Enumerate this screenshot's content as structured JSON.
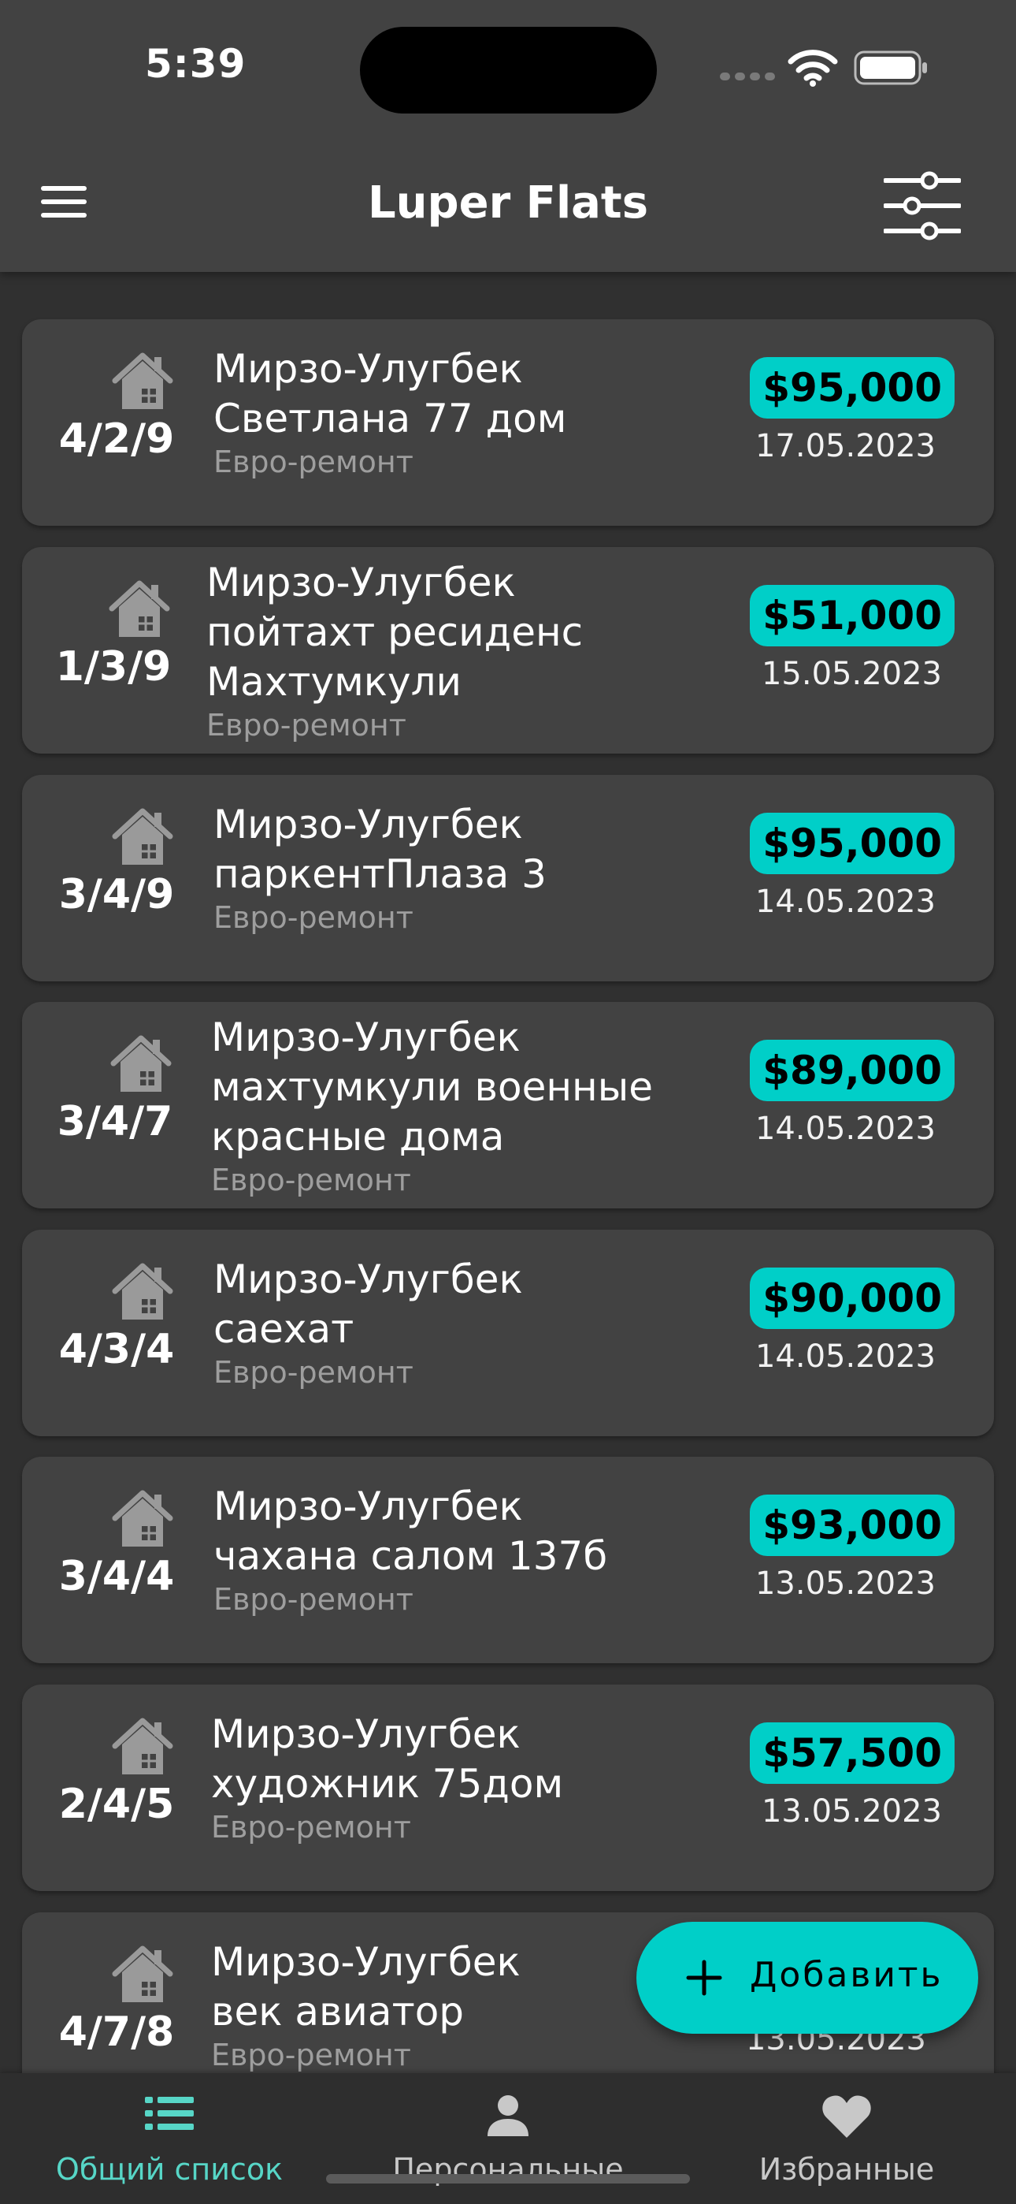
{
  "status_bar": {
    "time": "5:39"
  },
  "header": {
    "title": "Luper Flats"
  },
  "listings": [
    {
      "rooms": "4/2/9",
      "lines": [
        "Мирзо-Улугбек",
        "Светлана 77 дом"
      ],
      "repair": "Евро-ремонт",
      "price": "$95,000",
      "date": "17.05.2023"
    },
    {
      "rooms": "1/3/9",
      "lines": [
        "Мирзо-Улугбек",
        "пойтахт ресиденс",
        "Махтумкули"
      ],
      "repair": "Евро-ремонт",
      "price": "$51,000",
      "date": "15.05.2023"
    },
    {
      "rooms": "3/4/9",
      "lines": [
        "Мирзо-Улугбек",
        "паркентПлаза 3"
      ],
      "repair": "Евро-ремонт",
      "price": "$95,000",
      "date": "14.05.2023"
    },
    {
      "rooms": "3/4/7",
      "lines": [
        "Мирзо-Улугбек",
        "махтумкули военные",
        "красные дома"
      ],
      "repair": "Евро-ремонт",
      "price": "$89,000",
      "date": "14.05.2023"
    },
    {
      "rooms": "4/3/4",
      "lines": [
        "Мирзо-Улугбек",
        "саехат"
      ],
      "repair": "Евро-ремонт",
      "price": "$90,000",
      "date": "14.05.2023"
    },
    {
      "rooms": "3/4/4",
      "lines": [
        "Мирзо-Улугбек",
        "чахана салом  137б"
      ],
      "repair": "Евро-ремонт",
      "price": "$93,000",
      "date": "13.05.2023"
    },
    {
      "rooms": "2/4/5",
      "lines": [
        "Мирзо-Улугбек",
        "художник 75дом"
      ],
      "repair": "Евро-ремонт",
      "price": "$57,500",
      "date": "13.05.2023"
    },
    {
      "rooms": "4/7/8",
      "lines": [
        "Мирзо-Улугбек",
        "век авиатор"
      ],
      "repair": "Евро-ремонт",
      "price": "",
      "date": "13.05.2023"
    }
  ],
  "fab": {
    "label": "Добавить"
  },
  "bottom_nav": [
    {
      "label": "Общий список",
      "icon": "list-icon",
      "active": true
    },
    {
      "label": "Персональные",
      "icon": "person-icon",
      "active": false
    },
    {
      "label": "Избранные",
      "icon": "heart-icon",
      "active": false
    }
  ],
  "colors": {
    "accent": "#00cfc8",
    "active_tab": "#57d6c7",
    "card": "#424242",
    "background": "#303030"
  }
}
